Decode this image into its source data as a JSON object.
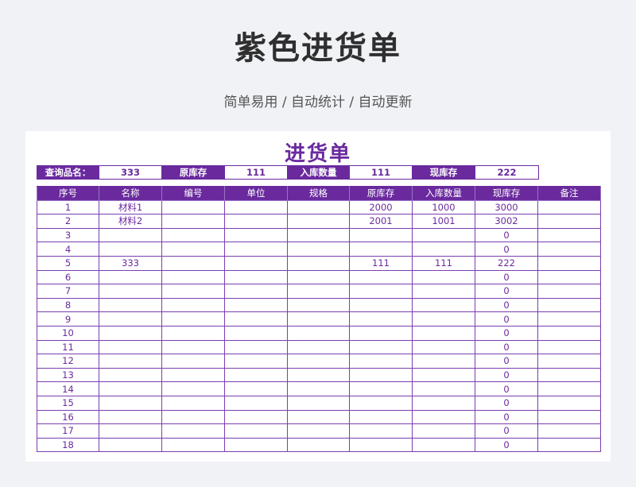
{
  "page": {
    "title": "紫色进货单",
    "subtitle": "简单易用 / 自动统计 / 自动更新"
  },
  "sheet": {
    "title": "进货单",
    "query_bar": [
      {
        "label": "查询品名：",
        "value": "333"
      },
      {
        "label": "原库存",
        "value": "111"
      },
      {
        "label": "入库数量",
        "value": "111"
      },
      {
        "label": "现库存",
        "value": "222"
      }
    ],
    "columns": [
      "序号",
      "名称",
      "编号",
      "单位",
      "规格",
      "原库存",
      "入库数量",
      "现库存",
      "备注"
    ],
    "rows": [
      [
        "1",
        "材料1",
        "",
        "",
        "",
        "2000",
        "1000",
        "3000",
        ""
      ],
      [
        "2",
        "材料2",
        "",
        "",
        "",
        "2001",
        "1001",
        "3002",
        ""
      ],
      [
        "3",
        "",
        "",
        "",
        "",
        "",
        "",
        "0",
        ""
      ],
      [
        "4",
        "",
        "",
        "",
        "",
        "",
        "",
        "0",
        ""
      ],
      [
        "5",
        "333",
        "",
        "",
        "",
        "111",
        "111",
        "222",
        ""
      ],
      [
        "6",
        "",
        "",
        "",
        "",
        "",
        "",
        "0",
        ""
      ],
      [
        "7",
        "",
        "",
        "",
        "",
        "",
        "",
        "0",
        ""
      ],
      [
        "8",
        "",
        "",
        "",
        "",
        "",
        "",
        "0",
        ""
      ],
      [
        "9",
        "",
        "",
        "",
        "",
        "",
        "",
        "0",
        ""
      ],
      [
        "10",
        "",
        "",
        "",
        "",
        "",
        "",
        "0",
        ""
      ],
      [
        "11",
        "",
        "",
        "",
        "",
        "",
        "",
        "0",
        ""
      ],
      [
        "12",
        "",
        "",
        "",
        "",
        "",
        "",
        "0",
        ""
      ],
      [
        "13",
        "",
        "",
        "",
        "",
        "",
        "",
        "0",
        ""
      ],
      [
        "14",
        "",
        "",
        "",
        "",
        "",
        "",
        "0",
        ""
      ],
      [
        "15",
        "",
        "",
        "",
        "",
        "",
        "",
        "0",
        ""
      ],
      [
        "16",
        "",
        "",
        "",
        "",
        "",
        "",
        "0",
        ""
      ],
      [
        "17",
        "",
        "",
        "",
        "",
        "",
        "",
        "0",
        ""
      ],
      [
        "18",
        "",
        "",
        "",
        "",
        "",
        "",
        "0",
        ""
      ]
    ]
  },
  "colors": {
    "accent": "#6a2a9e",
    "background": "#f1f2f5"
  }
}
